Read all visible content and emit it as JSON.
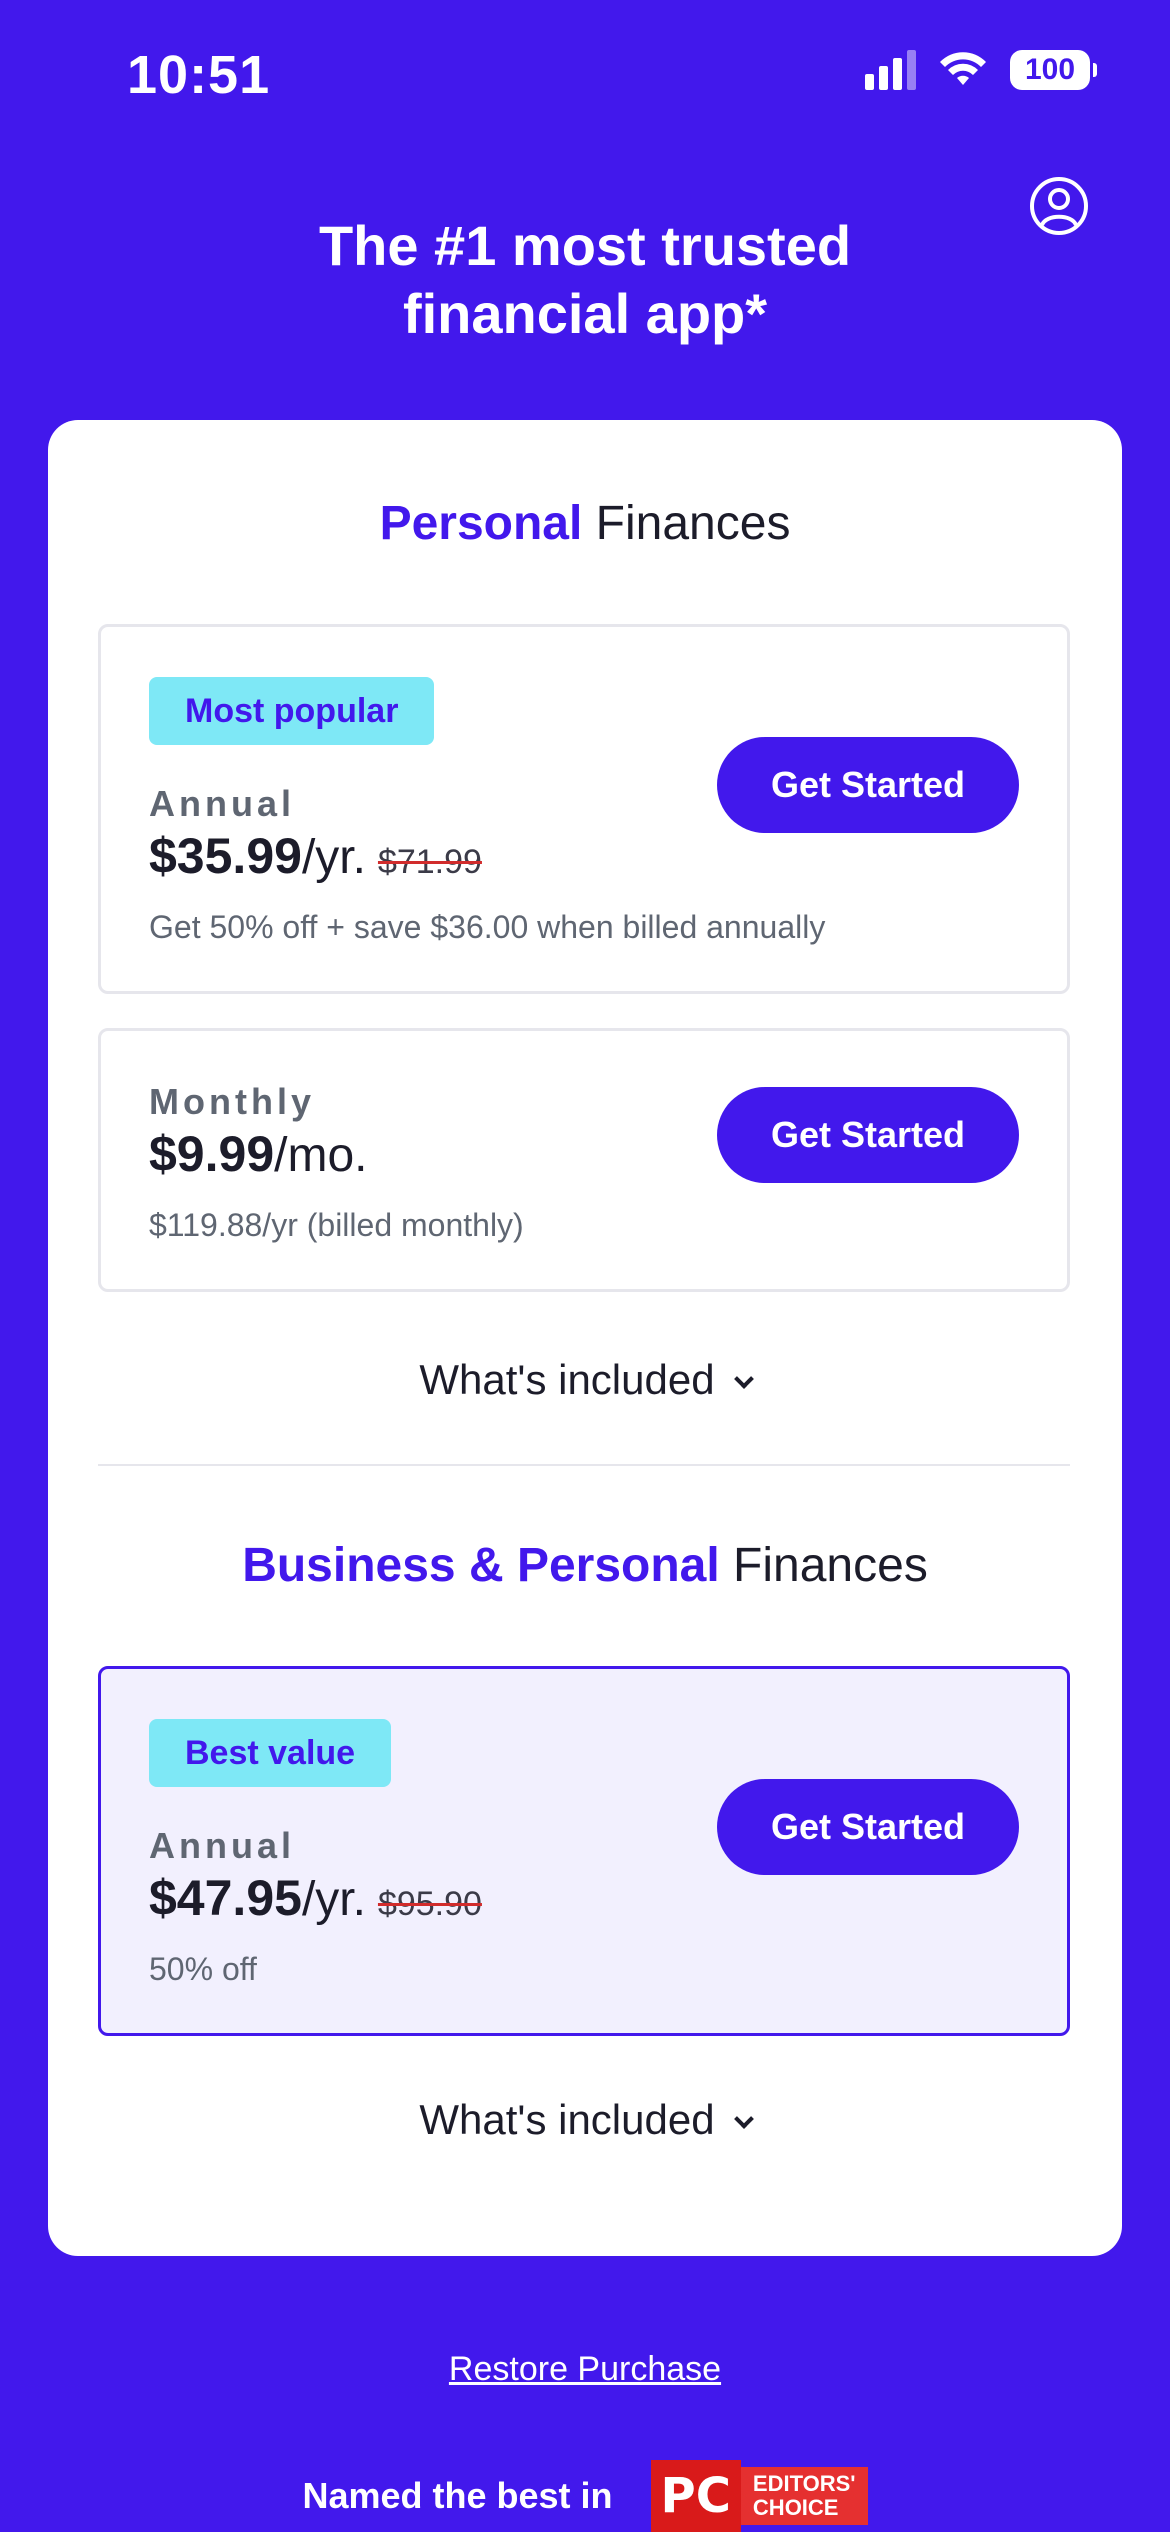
{
  "status_bar": {
    "time": "10:51",
    "battery": "100"
  },
  "header": {
    "title_line1": "The #1 most trusted",
    "title_line2": "financial app*"
  },
  "personal": {
    "title_accent": "Personal",
    "title_rest": "Finances",
    "annual": {
      "badge": "Most popular",
      "term": "Annual",
      "price": "$35.99",
      "period": "/yr.",
      "old_price": "$71.99",
      "note": "Get 50% off + save $36.00 when billed annually",
      "cta": "Get Started"
    },
    "monthly": {
      "term": "Monthly",
      "price": "$9.99",
      "period": "/mo.",
      "note": "$119.88/yr (billed monthly)",
      "cta": "Get Started"
    },
    "included_label": "What's included"
  },
  "business": {
    "title_accent": "Business & Personal",
    "title_rest": "Finances",
    "annual": {
      "badge": "Best value",
      "term": "Annual",
      "price": "$47.95",
      "period": "/yr.",
      "old_price": "$95.90",
      "note": "50% off",
      "cta": "Get Started"
    },
    "included_label": "What's included"
  },
  "footer": {
    "restore": "Restore Purchase",
    "named": "Named the best in",
    "badge_pc": "PC",
    "badge_line1": "EDITORS'",
    "badge_line2": "CHOICE"
  },
  "colors": {
    "brand": "#4218EC",
    "badge_bg": "#7EE8F6",
    "highlight_bg": "#F2F0FE"
  }
}
